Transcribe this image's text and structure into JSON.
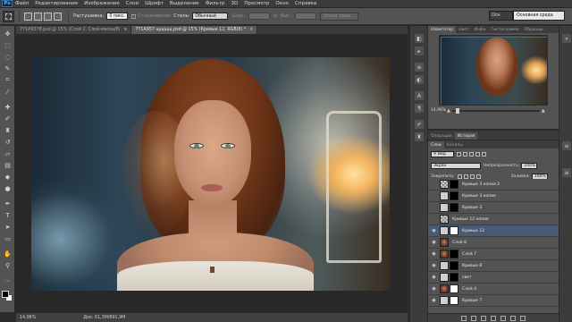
{
  "app": {
    "logo": "Ps"
  },
  "menu": [
    "Файл",
    "Редактирование",
    "Изображение",
    "Слои",
    "Шрифт",
    "Выделение",
    "Фильтр",
    "3D",
    "Просмотр",
    "Окно",
    "Справка"
  ],
  "options": {
    "feather_label": "Растушевка:",
    "feather_value": "0 пикс.",
    "antialias_label": "Сглаживание",
    "style_label": "Стиль:",
    "style_value": "Обычный",
    "width_label": "Шир.:",
    "height_label": "Выс.:",
    "refine_button": "Уточн. край...",
    "workspace_left": "Осн",
    "workspace_value": "Основная среда"
  },
  "tabs": [
    {
      "label": "7Y1A9378.psd @ 15% (Слой 2, Слой-маска/8)",
      "active": false
    },
    {
      "label": "7Y1A957  щщщщ.psd @ 15% (Кривые 12, RGB/8) *",
      "active": true
    }
  ],
  "status": {
    "zoom": "14,96%",
    "doc": "Док: 61,3M/691,9M"
  },
  "navigator": {
    "tabs": [
      "Навигатор",
      "Цвет",
      "Инфо",
      "Гистограмма",
      "Образцы"
    ],
    "zoom": "14,96%"
  },
  "history_tabs": [
    "Операции",
    "История"
  ],
  "layers": {
    "tabs": [
      "Слои",
      "Каналы"
    ],
    "filter_label": "Вид",
    "blend_mode": "Экран",
    "opacity_label": "Непрозрачность:",
    "opacity_value": "100%",
    "lock_label": "Закрепить:",
    "fill_label": "Заливка:",
    "fill_value": "100%",
    "items": [
      {
        "name": "Кривые 3 копия 2",
        "thumb": "checker",
        "mask": "mask-black",
        "visible": false,
        "selected": false
      },
      {
        "name": "Кривые 3 копия",
        "thumb": "curve",
        "mask": "mask-black",
        "visible": false,
        "selected": false
      },
      {
        "name": "Кривые 3",
        "thumb": "curve",
        "mask": "mask-black",
        "visible": false,
        "selected": false
      },
      {
        "name": "Кривые 12 копия",
        "thumb": "checker",
        "mask": "",
        "visible": false,
        "selected": false
      },
      {
        "name": "Кривые 12",
        "thumb": "curve",
        "mask": "mask-white",
        "visible": true,
        "selected": true
      },
      {
        "name": "Слой 8",
        "thumb": "photo-mini",
        "mask": "",
        "visible": true,
        "selected": false
      },
      {
        "name": "Слой 7",
        "thumb": "photo-mini",
        "mask": "mask-black",
        "visible": true,
        "selected": false
      },
      {
        "name": "Кривые 8",
        "thumb": "curve",
        "mask": "mask-black",
        "visible": true,
        "selected": false
      },
      {
        "name": "свет",
        "thumb": "curve",
        "mask": "mask-black",
        "visible": true,
        "selected": false
      },
      {
        "name": "Слой 4",
        "thumb": "photo-mini",
        "mask": "mask-white",
        "visible": true,
        "selected": false
      },
      {
        "name": "Кривые 7",
        "thumb": "curve",
        "mask": "mask-white",
        "visible": true,
        "selected": false
      }
    ]
  },
  "icons": {
    "tools": [
      "move-icon",
      "marquee-icon",
      "lasso-icon",
      "quick-select-icon",
      "crop-icon",
      "eyedropper-icon",
      "healing-icon",
      "brush-icon",
      "stamp-icon",
      "history-brush-icon",
      "eraser-icon",
      "gradient-icon",
      "blur-icon",
      "dodge-icon",
      "pen-icon",
      "type-icon",
      "path-select-icon",
      "shape-icon",
      "hand-icon",
      "zoom-icon"
    ]
  }
}
